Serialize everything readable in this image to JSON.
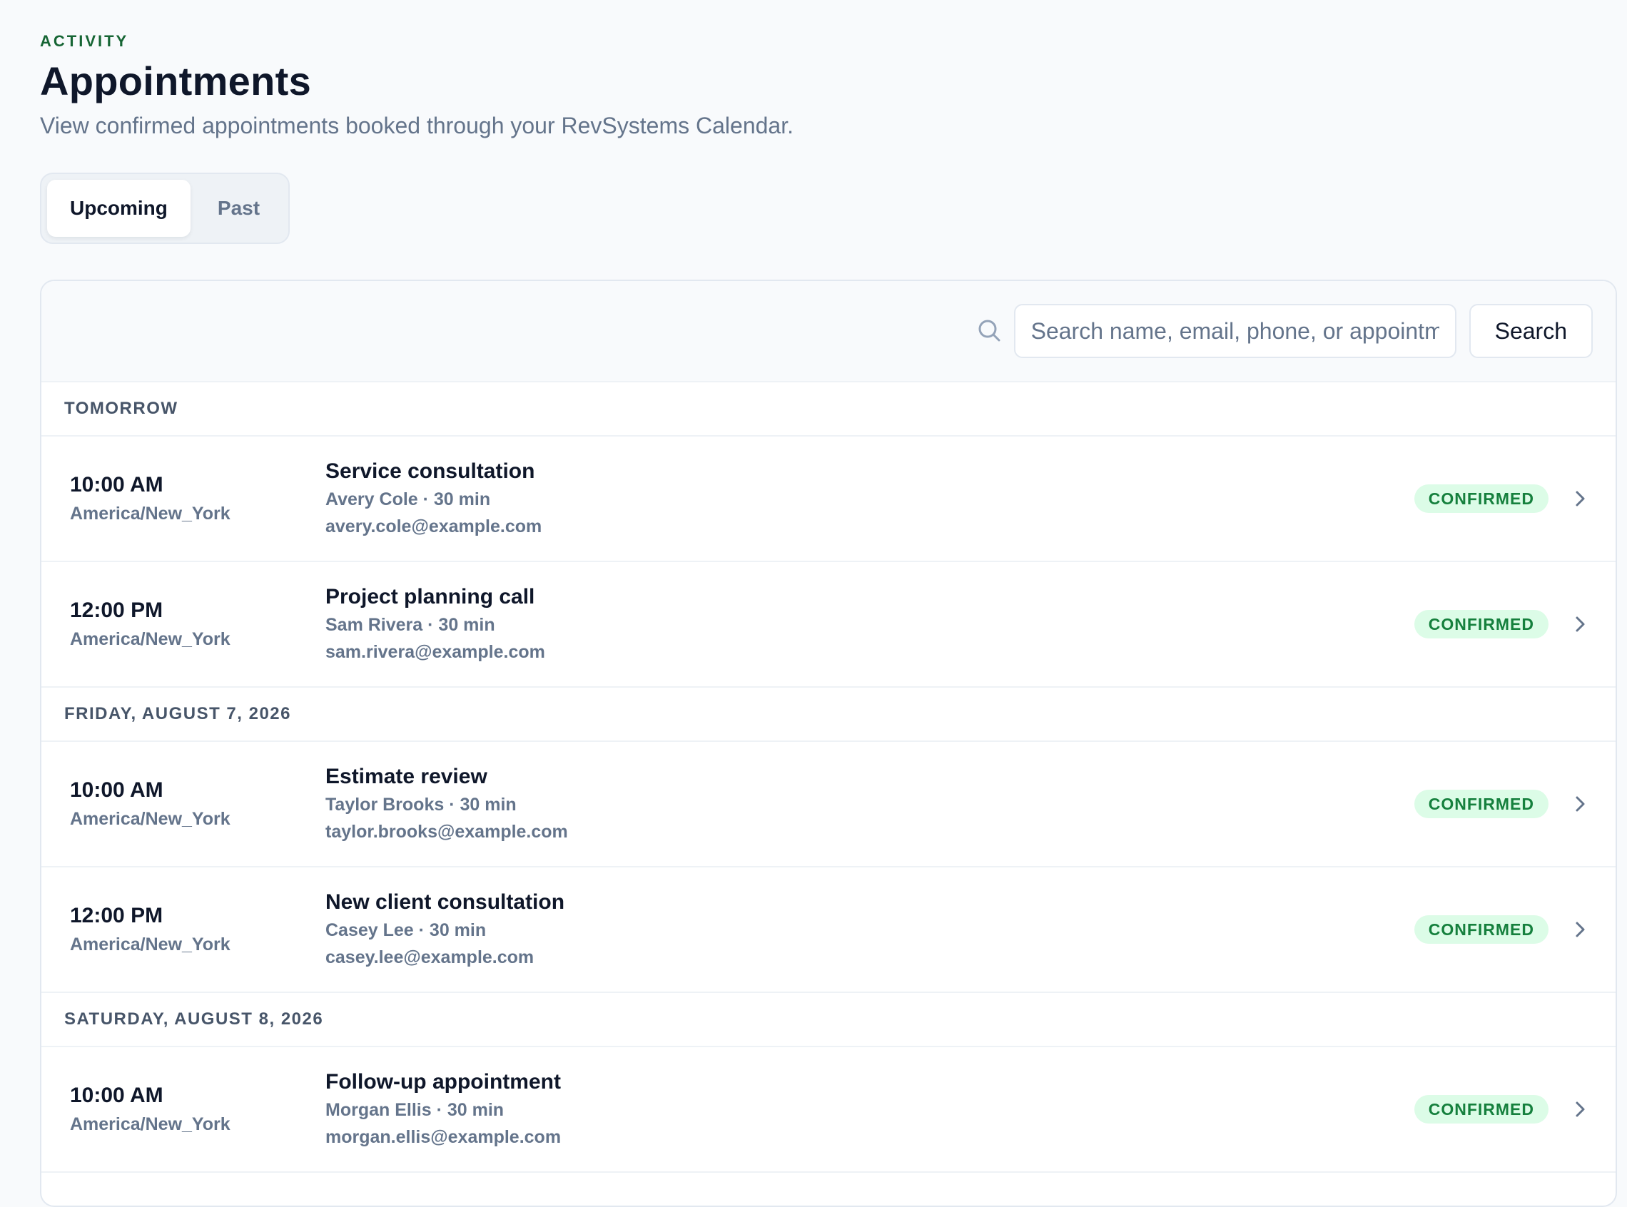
{
  "header": {
    "eyebrow": "ACTIVITY",
    "title": "Appointments",
    "subtitle": "View confirmed appointments booked through your RevSystems Calendar."
  },
  "tabs": [
    {
      "label": "Upcoming",
      "active": true
    },
    {
      "label": "Past",
      "active": false
    }
  ],
  "search": {
    "placeholder": "Search name, email, phone, or appointment ID",
    "value": "",
    "button_label": "Search",
    "icon": "search-icon"
  },
  "groups": [
    {
      "label": "TOMORROW",
      "appointments": [
        {
          "time": "10:00 AM",
          "tz": "America/New_York",
          "title": "Service consultation",
          "meta": "Avery Cole · 30 min",
          "email": "avery.cole@example.com",
          "status": "CONFIRMED"
        },
        {
          "time": "12:00 PM",
          "tz": "America/New_York",
          "title": "Project planning call",
          "meta": "Sam Rivera · 30 min",
          "email": "sam.rivera@example.com",
          "status": "CONFIRMED"
        }
      ]
    },
    {
      "label": "FRIDAY, AUGUST 7, 2026",
      "appointments": [
        {
          "time": "10:00 AM",
          "tz": "America/New_York",
          "title": "Estimate review",
          "meta": "Taylor Brooks · 30 min",
          "email": "taylor.brooks@example.com",
          "status": "CONFIRMED"
        },
        {
          "time": "12:00 PM",
          "tz": "America/New_York",
          "title": "New client consultation",
          "meta": "Casey Lee · 30 min",
          "email": "casey.lee@example.com",
          "status": "CONFIRMED"
        }
      ]
    },
    {
      "label": "SATURDAY, AUGUST 8, 2026",
      "appointments": [
        {
          "time": "10:00 AM",
          "tz": "America/New_York",
          "title": "Follow-up appointment",
          "meta": "Morgan Ellis · 30 min",
          "email": "morgan.ellis@example.com",
          "status": "CONFIRMED"
        }
      ]
    }
  ],
  "colors": {
    "accent": "#166534",
    "status_bg": "#dcfce7",
    "status_text": "#15803d",
    "page_bg": "#f8fafc"
  }
}
